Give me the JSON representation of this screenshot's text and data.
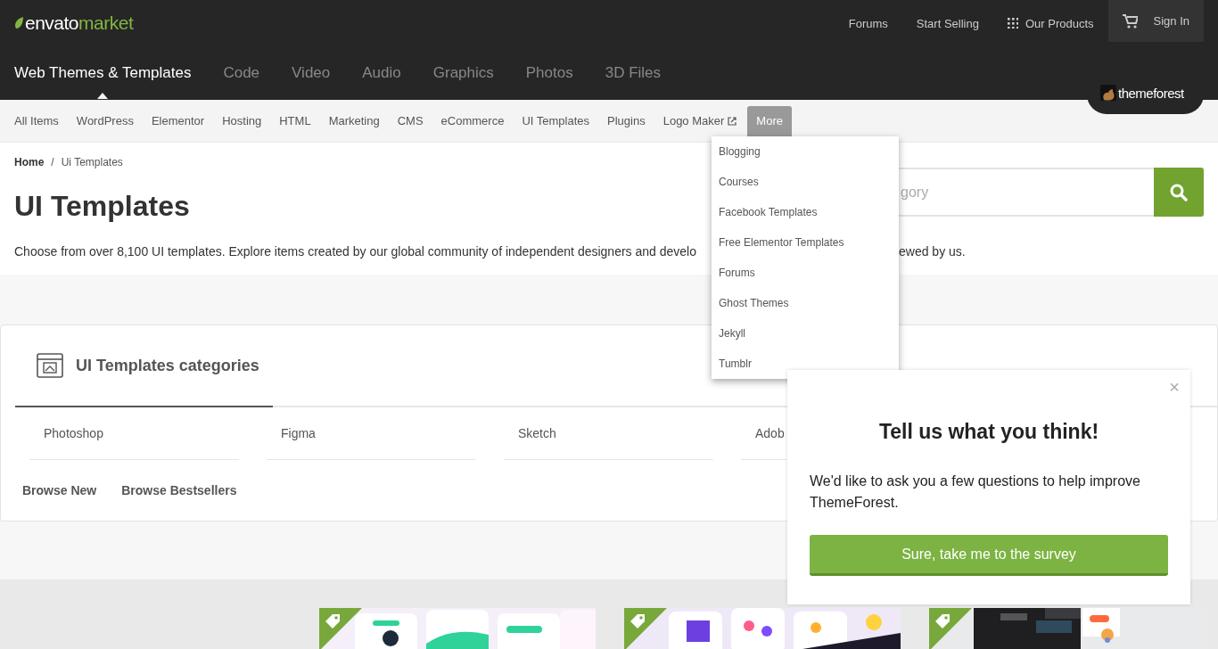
{
  "logo": {
    "word_1": "envato",
    "word_2": "market"
  },
  "top_links": [
    {
      "label": "Forums",
      "kind": "plain"
    },
    {
      "label": "Start Selling",
      "kind": "plain"
    },
    {
      "label": "Our Products",
      "kind": "grid"
    }
  ],
  "sign_in": "Sign In",
  "marketplaces": [
    {
      "label": "Web Themes & Templates",
      "selected": true
    },
    {
      "label": "Code",
      "selected": false
    },
    {
      "label": "Video",
      "selected": false
    },
    {
      "label": "Audio",
      "selected": false
    },
    {
      "label": "Graphics",
      "selected": false
    },
    {
      "label": "Photos",
      "selected": false
    },
    {
      "label": "3D Files",
      "selected": false
    }
  ],
  "brand_badge": "themeforest",
  "subnav": [
    {
      "label": "All Items",
      "kind": "plain",
      "expanded": false
    },
    {
      "label": "WordPress",
      "kind": "plain",
      "expanded": false
    },
    {
      "label": "Elementor",
      "kind": "plain",
      "expanded": false
    },
    {
      "label": "Hosting",
      "kind": "plain",
      "expanded": false
    },
    {
      "label": "HTML",
      "kind": "plain",
      "expanded": false
    },
    {
      "label": "Marketing",
      "kind": "plain",
      "expanded": false
    },
    {
      "label": "CMS",
      "kind": "plain",
      "expanded": false
    },
    {
      "label": "eCommerce",
      "kind": "plain",
      "expanded": false
    },
    {
      "label": "UI Templates",
      "kind": "plain",
      "expanded": false
    },
    {
      "label": "Plugins",
      "kind": "plain",
      "expanded": false
    },
    {
      "label": "Logo Maker",
      "kind": "external",
      "expanded": false
    },
    {
      "label": "More",
      "kind": "plain",
      "expanded": true
    }
  ],
  "more_menu": [
    "Blogging",
    "Courses",
    "Facebook Templates",
    "Free Elementor Templates",
    "Forums",
    "Ghost Themes",
    "Jekyll",
    "Tumblr"
  ],
  "breadcrumb": [
    "Home",
    "/",
    "Ui Templates"
  ],
  "title": "UI Templates",
  "description_start": "Choose from over 8,100 UI templates. Explore items created by our global community of independent designers and develo",
  "description_end": "ewed by us.",
  "search": {
    "placeholder": "gory"
  },
  "categories": {
    "title": "UI Templates categories",
    "items": [
      "Photoshop",
      "Figma",
      "Sketch",
      "Adob"
    ],
    "links": [
      "Browse New",
      "Browse Bestsellers"
    ]
  },
  "products": [
    {
      "kind": "picture"
    },
    {
      "kind": "picture"
    },
    {
      "kind": "picture"
    }
  ],
  "survey": {
    "close": "×",
    "title": "Tell us what you think!",
    "text": "We'd like to ask you a few questions to help improve ThemeForest.",
    "button": "Sure, take me to the survey"
  }
}
